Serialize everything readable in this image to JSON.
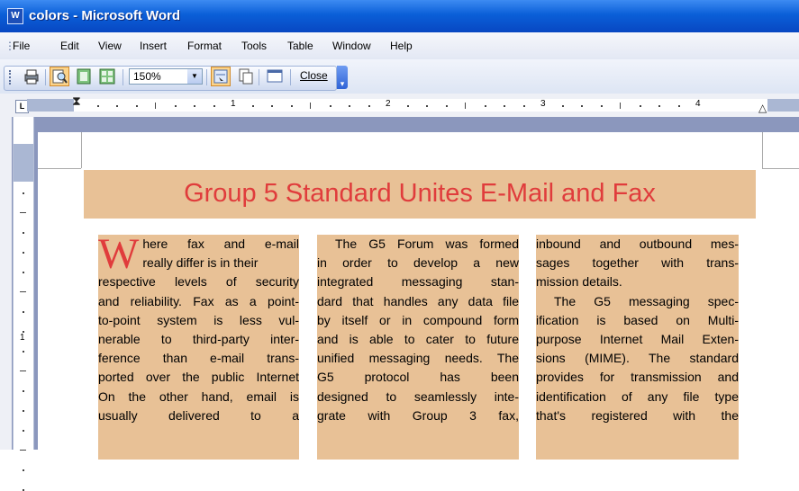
{
  "window": {
    "title": "colors - Microsoft Word",
    "app_icon": "word-doc-icon"
  },
  "menu": {
    "items": [
      "File",
      "Edit",
      "View",
      "Insert",
      "Format",
      "Tools",
      "Table",
      "Window",
      "Help"
    ]
  },
  "toolbar": {
    "zoom_value": "150%",
    "close_label": "Close",
    "icons": [
      "print-icon",
      "magnifier-icon",
      "one-page-icon",
      "multiple-pages-icon",
      "zoom-dropdown",
      "view-ruler-icon",
      "shrink-to-fit-icon",
      "full-screen-icon",
      "close-button",
      "toolbar-options-icon"
    ]
  },
  "ruler": {
    "numbers": [
      "1",
      "2",
      "3",
      "4"
    ],
    "vertical_number": "1"
  },
  "document": {
    "heading": "Group 5 Standard Unites E-Mail and Fax",
    "dropcap": "W",
    "col1_first_a": "here fax and e-mail",
    "col1_first_b": "really differ is in their",
    "col1_lines": [
      "respective levels of security",
      "and reliability. Fax as a point-",
      "to-point system is less vul-",
      "nerable to third-party inter-",
      "ference than e-mail trans-",
      "ported over the public Internet",
      "On the other hand, email is",
      "usually delivered to a"
    ],
    "col2_lines": [
      "The G5 Forum was formed",
      "in order to develop a new",
      "integrated messaging stan-",
      "dard that handles any data file",
      "by itself or in compound form",
      "and is able to cater to future",
      "unified messaging needs. The",
      "G5 protocol has been",
      "designed to seamlessly inte-",
      "grate with Group 3 fax,"
    ],
    "col3_lines": [
      "inbound and outbound mes-",
      "sages together with trans-",
      "mission details.",
      "The G5 messaging spec-",
      "ification is based on Multi-",
      "purpose Internet Mail Exten-",
      "sions (MIME). The standard",
      "provides for transmission and",
      "identification of any file type",
      "that's registered with the"
    ]
  },
  "colors": {
    "accent_red": "#e03c3c",
    "column_bg": "#e8c196",
    "titlebar": "#0a5fd8"
  }
}
